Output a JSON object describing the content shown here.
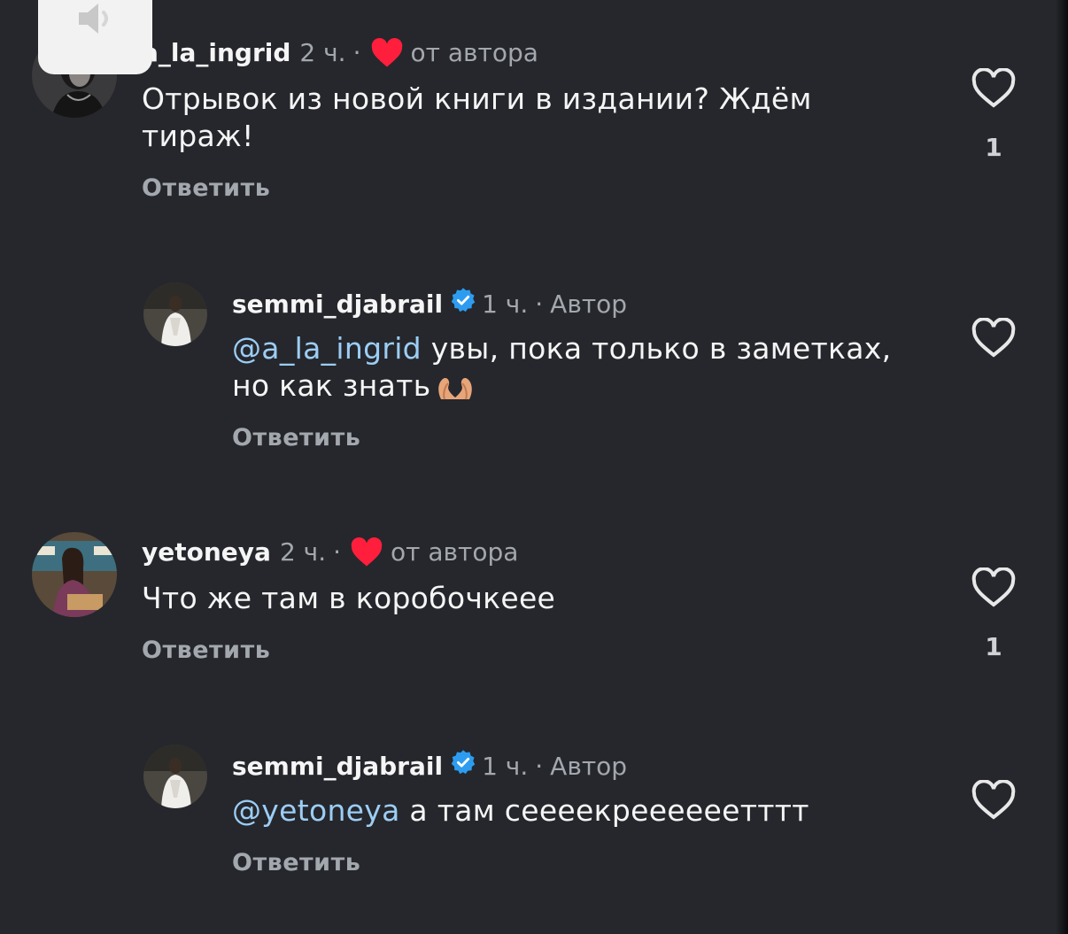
{
  "comments": [
    {
      "username": "a_la_ingrid",
      "time": "2 ч.",
      "author_liked_label": "от автора",
      "text": "Отрывок из новой книги в издании? Ждём тираж!",
      "reply_label": "Ответить",
      "like_count": "1"
    },
    {
      "username": "semmi_djabrail",
      "time": "1 ч.",
      "author_badge": "Автор",
      "mention": "@a_la_ingrid",
      "text": " увы, пока только в заметках, но как знать",
      "reply_label": "Ответить"
    },
    {
      "username": "yetoneya",
      "time": "2 ч.",
      "author_liked_label": "от автора",
      "text": "Что же там в коробочкеее",
      "reply_label": "Ответить",
      "like_count": "1"
    },
    {
      "username": "semmi_djabrail",
      "time": "1 ч.",
      "author_badge": "Автор",
      "mention": "@yetoneya",
      "text": " а там сеееекреееееетттт",
      "reply_label": "Ответить"
    }
  ],
  "separator": "·",
  "icons": {
    "like": "heart-outline-icon",
    "author_like": "red-heart-icon",
    "verified": "verified-badge-icon",
    "mute": "speaker-muted-icon",
    "emoji": "heart-hands-emoji"
  },
  "colors": {
    "background": "#25272c",
    "mention": "#9ccdf5",
    "author_heart": "#ff1f3d",
    "verified": "#2d9cf0",
    "muted_text": "#a3a7ae"
  }
}
